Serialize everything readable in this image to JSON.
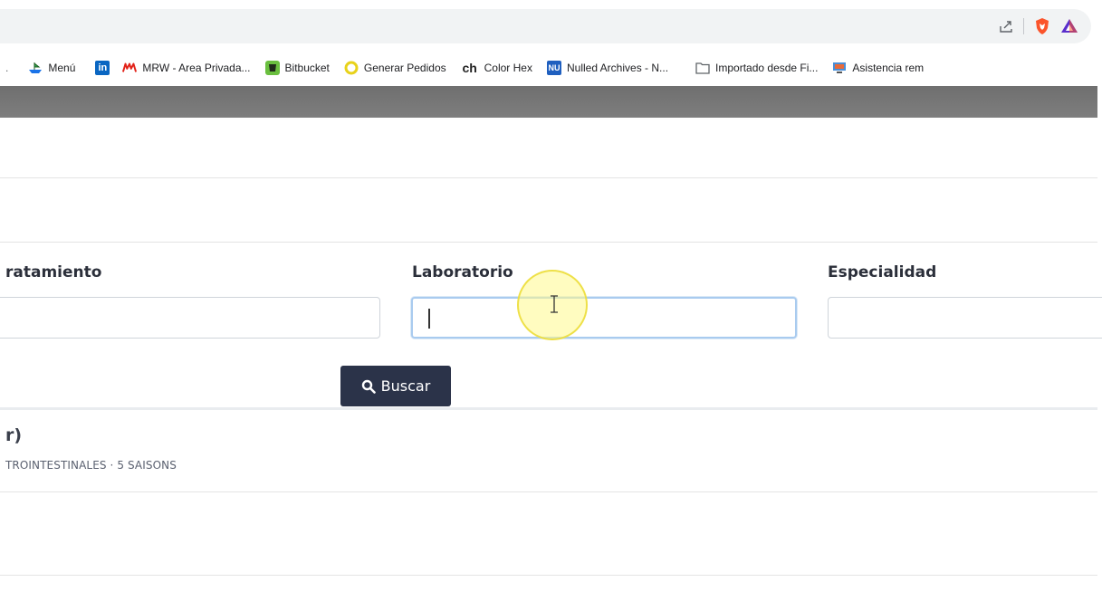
{
  "browser": {
    "bookmarks": [
      {
        "icon": "menu-ship-icon",
        "label": "Menú"
      },
      {
        "icon": "linkedin-icon",
        "label": ""
      },
      {
        "icon": "mrw-icon",
        "label": "MRW - Area Privada..."
      },
      {
        "icon": "bitbucket-icon",
        "label": "Bitbucket"
      },
      {
        "icon": "circle-icon",
        "label": "Generar Pedidos"
      },
      {
        "icon": "ch-icon",
        "label": "Color Hex"
      },
      {
        "icon": "nu-icon",
        "label": "Nulled Archives - N..."
      },
      {
        "icon": "folder-icon",
        "label": "Importado desde Fi..."
      },
      {
        "icon": "remote-icon",
        "label": "Asistencia rem"
      }
    ],
    "ch_glyph": "ch",
    "nu_glyph": "NU",
    "linkedin_glyph": "in",
    "bookmark_ellipsis": "."
  },
  "filters": {
    "tratamiento_label": "ratamiento",
    "laboratorio_label": "Laboratorio",
    "especialidad_label": "Especialidad",
    "tratamiento_value": "",
    "laboratorio_value": "",
    "especialidad_value": "",
    "search_button_label": "Buscar"
  },
  "results": {
    "title": "r)",
    "subtitle": "TROINTESTINALES · 5 SAISONS"
  },
  "colors": {
    "header_bar": "#7a7a7a",
    "button_bg": "#2b3349",
    "focus_border": "#a9cbef",
    "brave_orange": "#fb542b",
    "rewards_purple": "#5a2ecb"
  }
}
